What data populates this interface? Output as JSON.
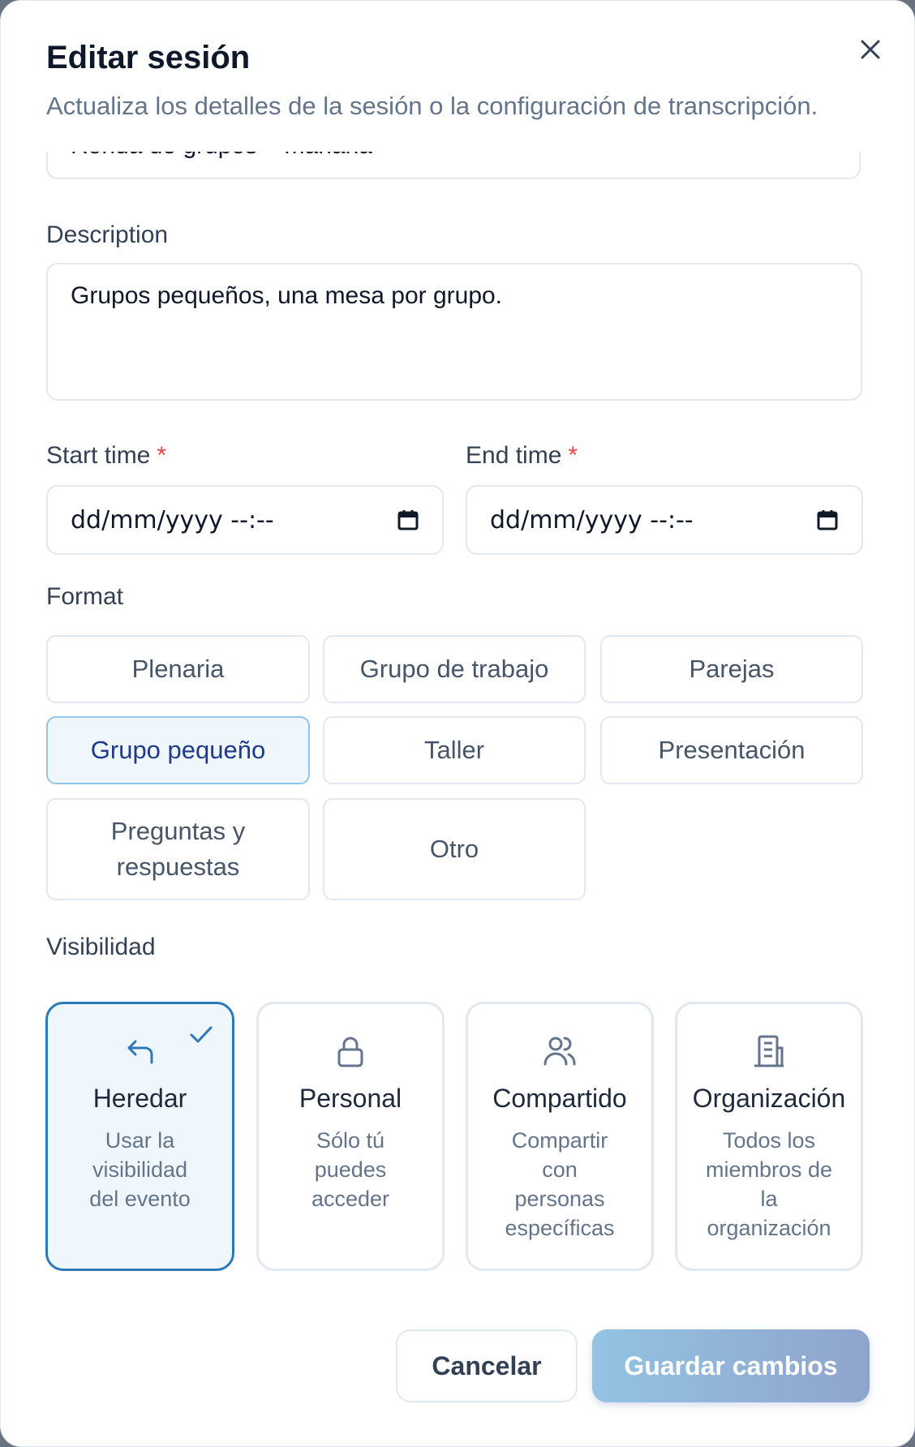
{
  "dialog": {
    "title": "Editar sesión",
    "subtitle": "Actualiza los detalles de la sesión o la configuración de transcripción.",
    "close_icon": "close-icon"
  },
  "form": {
    "name_value": "Ronda de grupos – mañana",
    "description_label": "Description",
    "description_value": "Grupos pequeños, una mesa por grupo.",
    "start_label": "Start time",
    "end_label": "End time",
    "required_mark": "*",
    "start_value": "dd/mm/yyyy --:--",
    "end_value": "dd/mm/yyyy --:--",
    "format_label": "Format",
    "formats": [
      "Plenaria",
      "Grupo de trabajo",
      "Parejas",
      "Grupo pequeño",
      "Taller",
      "Presentación",
      "Preguntas y respuestas",
      "Otro"
    ],
    "selected_format": "Grupo pequeño",
    "visibility_label": "Visibilidad",
    "visibility": [
      {
        "title": "Heredar",
        "desc": "Usar la visibilidad del evento",
        "icon": "reply-arrow-icon",
        "selected": true
      },
      {
        "title": "Personal",
        "desc": "Sólo tú puedes acceder",
        "icon": "lock-icon",
        "selected": false
      },
      {
        "title": "Compartido",
        "desc": "Compartir con personas específicas",
        "icon": "users-icon",
        "selected": false
      },
      {
        "title": "Organización",
        "desc": "Todos los miembros de la organización",
        "icon": "building-icon",
        "selected": false
      }
    ]
  },
  "footer": {
    "cancel_label": "Cancelar",
    "save_label": "Guardar cambios"
  },
  "colors": {
    "accent": "#2a7ab8",
    "selected_bg": "#f0f7fc",
    "required": "#ef4444",
    "save_gradient_start": "#93c3e3",
    "save_gradient_end": "#8fa4cd"
  }
}
